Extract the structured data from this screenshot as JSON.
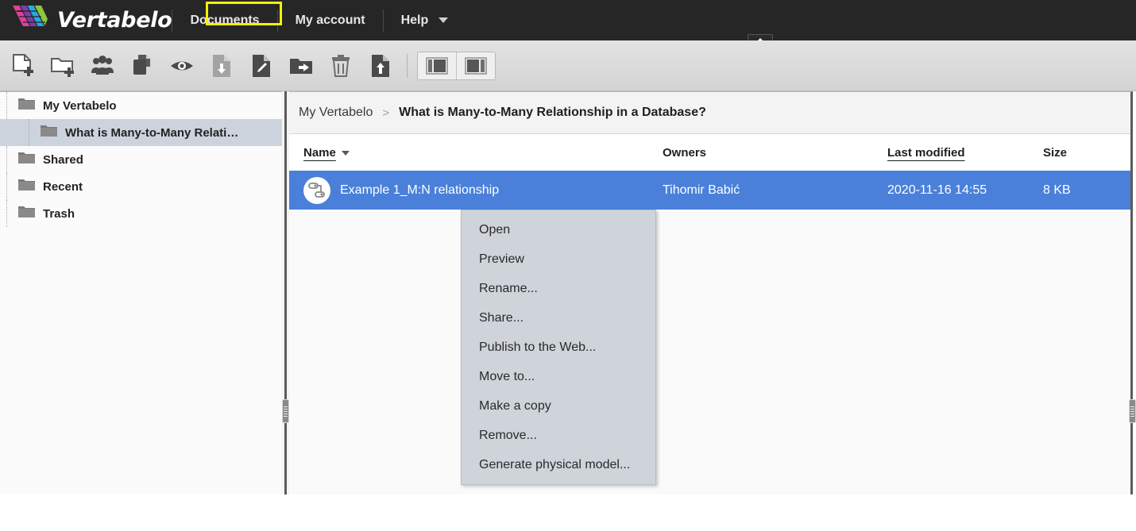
{
  "app": {
    "brand": "Vertabelo",
    "logo_icon": "vertabelo-diamond-logo",
    "accent_blue": "#4a80da",
    "highlight_yellow": "#ffee00",
    "header_bg": "#262626"
  },
  "topnav": {
    "items": [
      {
        "label": "Documents",
        "name": "nav-documents",
        "highlighted": true
      },
      {
        "label": "My account",
        "name": "nav-my-account",
        "highlighted": false
      },
      {
        "label": "Help",
        "name": "nav-help",
        "highlighted": false,
        "caret": true
      }
    ],
    "collapse_tab_icon": "triangle-up-icon"
  },
  "toolbar": {
    "buttons": [
      {
        "name": "new-document-button",
        "icon": "new-document-icon",
        "title": "New document"
      },
      {
        "name": "new-folder-button",
        "icon": "new-folder-icon",
        "title": "New folder"
      },
      {
        "name": "share-button",
        "icon": "users-group-icon",
        "title": "Share"
      },
      {
        "name": "copy-button",
        "icon": "copy-documents-icon",
        "title": "Make a copy"
      },
      {
        "name": "preview-button",
        "icon": "eye-icon",
        "title": "Preview"
      },
      {
        "name": "download-button",
        "icon": "document-download-icon",
        "title": "Download"
      },
      {
        "name": "rename-button",
        "icon": "document-edit-icon",
        "title": "Rename"
      },
      {
        "name": "move-to-button",
        "icon": "folder-arrow-icon",
        "title": "Move to"
      },
      {
        "name": "delete-button",
        "icon": "trash-icon",
        "title": "Remove"
      },
      {
        "name": "upload-button",
        "icon": "document-upload-icon",
        "title": "Upload"
      }
    ],
    "view_buttons": [
      {
        "name": "view-layout-left-button",
        "icon": "layout-left-panel-icon"
      },
      {
        "name": "view-layout-right-button",
        "icon": "layout-right-panel-icon"
      }
    ]
  },
  "sidebar": {
    "items": [
      {
        "label": "My Vertabelo",
        "icon": "folder-icon",
        "level": 1,
        "selected": false,
        "name": "sidebar-item-my-vertabelo"
      },
      {
        "label": "What is Many-to-Many Relati…",
        "icon": "folder-icon",
        "level": 2,
        "selected": true,
        "name": "sidebar-item-many-to-many-folder"
      },
      {
        "label": "Shared",
        "icon": "folder-icon",
        "level": 1,
        "selected": false,
        "name": "sidebar-item-shared"
      },
      {
        "label": "Recent",
        "icon": "folder-icon",
        "level": 1,
        "selected": false,
        "name": "sidebar-item-recent"
      },
      {
        "label": "Trash",
        "icon": "folder-icon",
        "level": 1,
        "selected": false,
        "name": "sidebar-item-trash"
      }
    ]
  },
  "breadcrumb": {
    "root": "My Vertabelo",
    "separator": ">",
    "current": "What is Many-to-Many Relationship in a Database?"
  },
  "table": {
    "columns": [
      {
        "label": "Name",
        "sorted": true,
        "sort_dir": "desc",
        "name": "column-header-name"
      },
      {
        "label": "Owners",
        "sorted": false,
        "name": "column-header-owners"
      },
      {
        "label": "Last modified",
        "sorted": false,
        "underlined": true,
        "name": "column-header-last-modified"
      },
      {
        "label": "Size",
        "sorted": false,
        "name": "column-header-size"
      }
    ],
    "rows": [
      {
        "icon": "er-model-icon",
        "name": "Example 1_M:N relationship",
        "owner": "Tihomir Babić",
        "modified": "2020-11-16 14:55",
        "size": "8 KB",
        "selected": true
      }
    ]
  },
  "context_menu": {
    "items": [
      {
        "label": "Open",
        "name": "context-menu-open",
        "highlighted": false
      },
      {
        "label": "Preview",
        "name": "context-menu-preview",
        "highlighted": false
      },
      {
        "label": "Rename...",
        "name": "context-menu-rename",
        "highlighted": false
      },
      {
        "label": "Share...",
        "name": "context-menu-share",
        "highlighted": false
      },
      {
        "label": "Publish to the Web...",
        "name": "context-menu-publish",
        "highlighted": false
      },
      {
        "label": "Move to...",
        "name": "context-menu-move-to",
        "highlighted": false
      },
      {
        "label": "Make a copy",
        "name": "context-menu-make-a-copy",
        "highlighted": false
      },
      {
        "label": "Remove...",
        "name": "context-menu-remove",
        "highlighted": false
      },
      {
        "label": "Generate physical model...",
        "name": "context-menu-generate-physical-model",
        "highlighted": true
      }
    ]
  }
}
